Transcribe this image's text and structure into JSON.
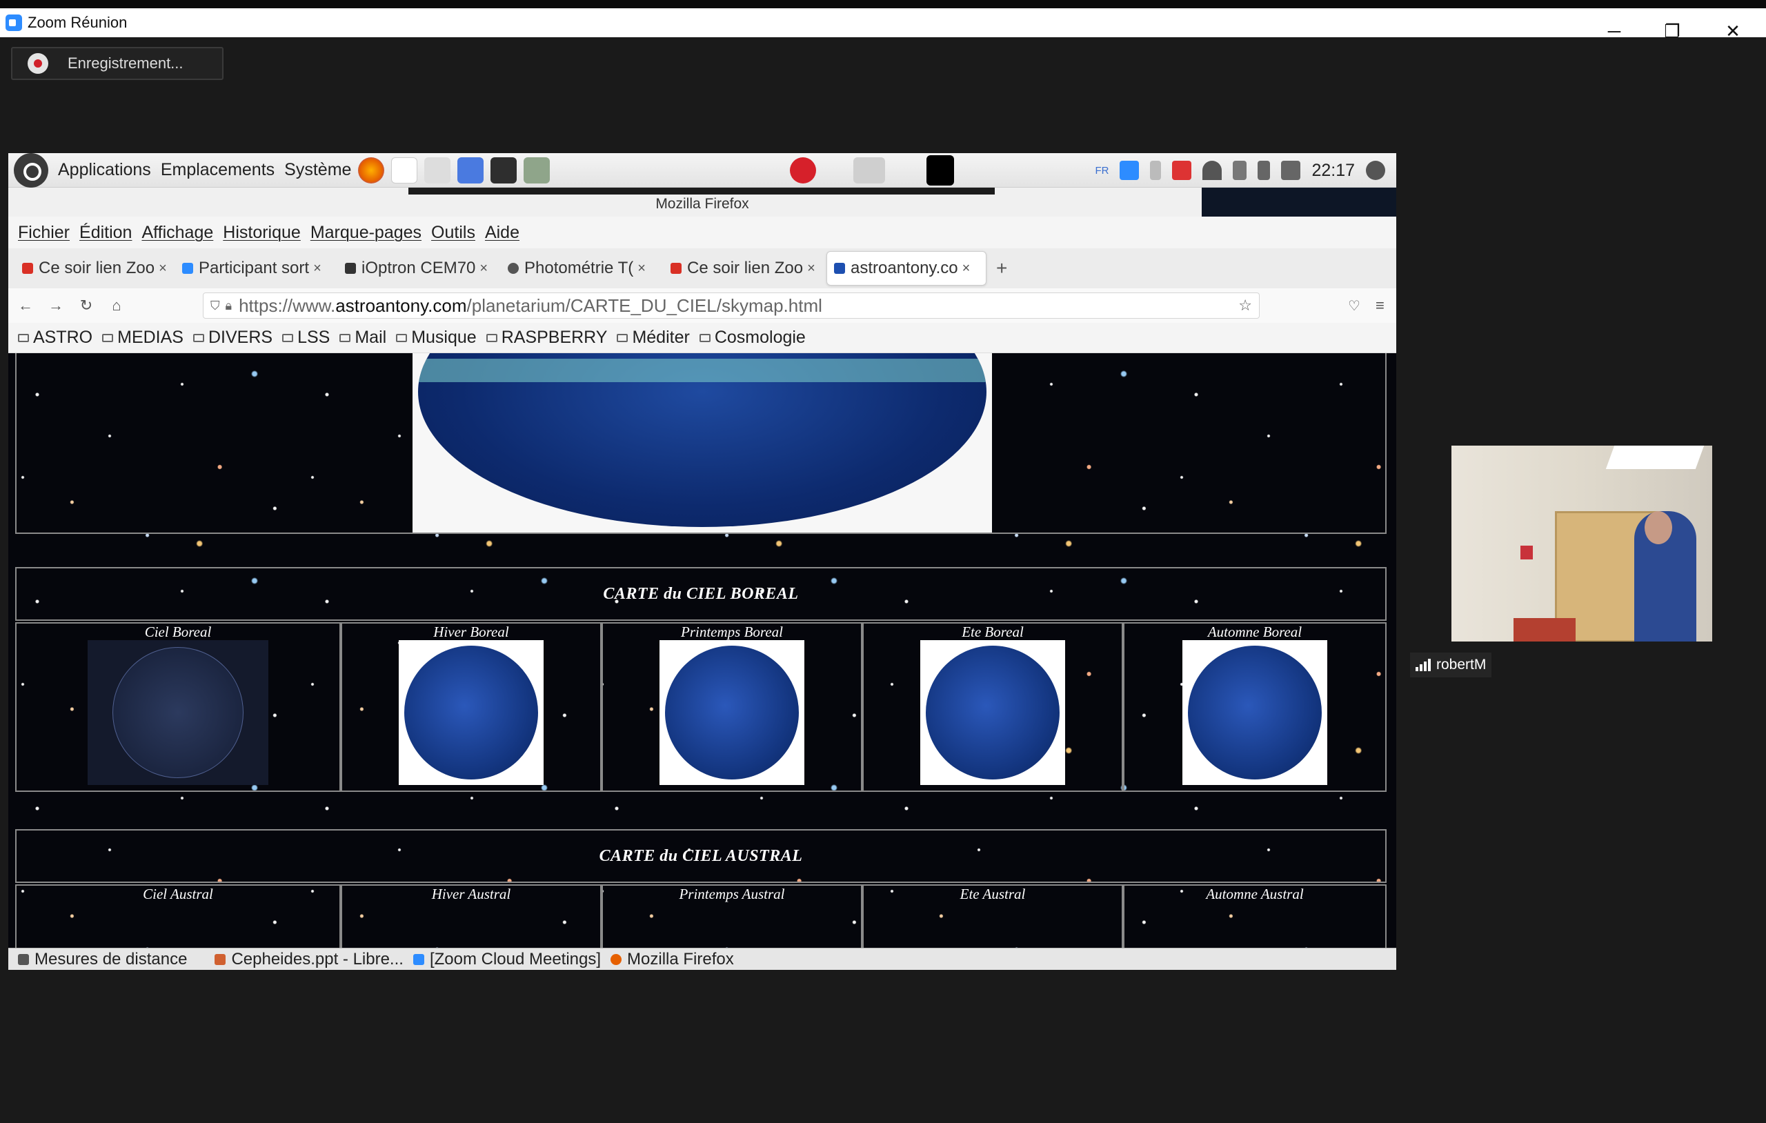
{
  "zoom": {
    "window_title": "Zoom Réunion",
    "recording_label": "Enregistrement...",
    "participant_name": "robertM",
    "controls": {
      "minimize": "─",
      "maximize": "❐",
      "close": "✕"
    }
  },
  "desktop_panel": {
    "menus": [
      "Applications",
      "Emplacements",
      "Système"
    ],
    "keyboard_layout": "FR",
    "clock": "22:17"
  },
  "firefox": {
    "window_title": "Mozilla Firefox",
    "menubar": [
      "Fichier",
      "Édition",
      "Affichage",
      "Historique",
      "Marque-pages",
      "Outils",
      "Aide"
    ],
    "tabs": [
      {
        "label": "Ce soir lien Zoo",
        "favicon_color": "#d93025"
      },
      {
        "label": "Participant sort",
        "favicon_color": "#2d8cff"
      },
      {
        "label": "iOptron CEM70",
        "favicon_color": "#333333"
      },
      {
        "label": "Photométrie T(",
        "favicon_color": "#555555"
      },
      {
        "label": "Ce soir lien Zoo",
        "favicon_color": "#d93025"
      },
      {
        "label": "astroantony.co",
        "favicon_color": "#1d4fb0",
        "active": true
      }
    ],
    "new_tab": "+",
    "tab_close": "×",
    "url": {
      "prefix": "https://www.",
      "domain": "astroantony.com",
      "path": "/planetarium/CARTE_DU_CIEL/skymap.html"
    },
    "bookmarks": [
      "ASTRO",
      "MEDIAS",
      "DIVERS",
      "LSS",
      "Mail",
      "Musique",
      "RASPBERRY",
      "Méditer",
      "Cosmologie"
    ]
  },
  "page": {
    "section_boreal": "CARTE du CIEL BOREAL",
    "section_austral": "CARTE du CIEL AUSTRAL",
    "boreal_maps": [
      "Ciel Boreal",
      "Hiver Boreal",
      "Printemps Boreal",
      "Ete Boreal",
      "Automne Boreal"
    ],
    "austral_maps": [
      "Ciel Austral",
      "Hiver Austral",
      "Printemps Austral",
      "Ete Austral",
      "Automne Austral"
    ]
  },
  "taskbar": {
    "items": [
      "Mesures de distance",
      "Cepheides.ppt - Libre...",
      "[Zoom Cloud Meetings]",
      "Mozilla Firefox"
    ]
  },
  "colors": {
    "zoom_blue": "#2d8cff",
    "record_red": "#d0202a",
    "power_red": "#d6202a"
  }
}
